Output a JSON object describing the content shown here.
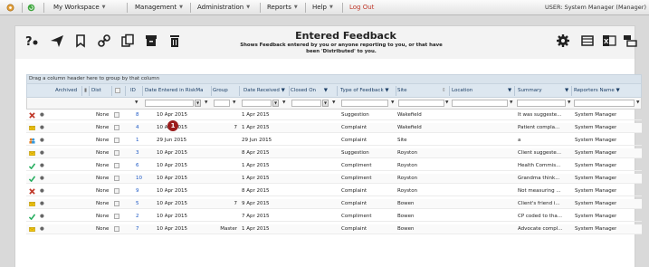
{
  "menu": {
    "items": [
      "My Workspace",
      "Management",
      "Administration",
      "Reports",
      "Help",
      "Log Out"
    ],
    "user": "USER: System Manager (Manager)"
  },
  "page": {
    "title": "Entered Feedback",
    "subtitle_line1": "Shows Feedback entered by you or anyone reporting to you, or that have",
    "subtitle_line2": "been 'Distributed' to you."
  },
  "toolbar_icons": [
    "help-icon",
    "send-icon",
    "bookmark-icon",
    "link-icon",
    "copy-icon",
    "archive-icon",
    "delete-icon",
    "settings-icon",
    "grid-view-icon",
    "export-excel-icon",
    "layout-icon"
  ],
  "grid": {
    "group_hint": "Drag a column header here to group by that column",
    "headers": {
      "archived": "Archived",
      "dist": "Dist",
      "id": "ID",
      "date_entered": "Date Entered in RiskMa",
      "group": "Group",
      "date_received": "Date Received",
      "closed_on": "Closed On",
      "type": "Type of Feedback",
      "site": "Site",
      "location": "Location",
      "summary": "Summary",
      "reporters_name": "Reporters Name"
    },
    "rows": [
      {
        "icon": "cross-icon",
        "dist": "None",
        "id": "8",
        "date_entered": "10 Apr 2015",
        "group": "",
        "date_received": "1 Apr 2015",
        "type": "Suggestion",
        "site": "Wakefield",
        "summary": "It was suggeste...",
        "reporter": "System Manager"
      },
      {
        "icon": "envelope-icon",
        "dist": "None",
        "id": "4",
        "date_entered": "10 Apr 2015",
        "group": "7",
        "date_received": "1 Apr 2015",
        "type": "Complaint",
        "site": "Wakefield",
        "summary": "Patient compla...",
        "reporter": "System Manager"
      },
      {
        "icon": "people-icon",
        "dist": "None",
        "id": "1",
        "date_entered": "29 Jun 2015",
        "group": "",
        "date_received": "29 Jun 2015",
        "type": "Complaint",
        "site": "Site",
        "summary": "a",
        "reporter": "System Manager"
      },
      {
        "icon": "envelope-icon",
        "dist": "None",
        "id": "3",
        "date_entered": "10 Apr 2015",
        "group": "",
        "date_received": "8 Apr 2015",
        "type": "Suggestion",
        "site": "Royston",
        "summary": "Client suggeste...",
        "reporter": "System Manager"
      },
      {
        "icon": "check-icon",
        "dist": "None",
        "id": "6",
        "date_entered": "10 Apr 2015",
        "group": "",
        "date_received": "1 Apr 2015",
        "type": "Compliment",
        "site": "Royston",
        "summary": "Health Commis...",
        "reporter": "System Manager"
      },
      {
        "icon": "check-icon",
        "dist": "None",
        "id": "10",
        "date_entered": "10 Apr 2015",
        "group": "",
        "date_received": "1 Apr 2015",
        "type": "Compliment",
        "site": "Royston",
        "summary": "Grandma think...",
        "reporter": "System Manager"
      },
      {
        "icon": "cross-icon",
        "dist": "None",
        "id": "9",
        "date_entered": "10 Apr 2015",
        "group": "",
        "date_received": "8 Apr 2015",
        "type": "Complaint",
        "site": "Royston",
        "summary": "Not measuring ...",
        "reporter": "System Manager"
      },
      {
        "icon": "envelope-icon",
        "dist": "None",
        "id": "5",
        "date_entered": "10 Apr 2015",
        "group": "7",
        "date_received": "9 Apr 2015",
        "type": "Complaint",
        "site": "Bowen",
        "summary": "Client's friend i...",
        "reporter": "System Manager"
      },
      {
        "icon": "check-icon",
        "dist": "None",
        "id": "2",
        "date_entered": "10 Apr 2015",
        "group": "",
        "date_received": "7 Apr 2015",
        "type": "Compliment",
        "site": "Bowen",
        "summary": "CP coded to tha...",
        "reporter": "System Manager"
      },
      {
        "icon": "envelope-icon",
        "dist": "None",
        "id": "7",
        "date_entered": "10 Apr 2015",
        "group": "Master",
        "date_received": "1 Apr 2015",
        "type": "Complaint",
        "site": "Bowen",
        "summary": "Advocate compl...",
        "reporter": "System Manager"
      }
    ]
  },
  "annotation_badge": "1"
}
